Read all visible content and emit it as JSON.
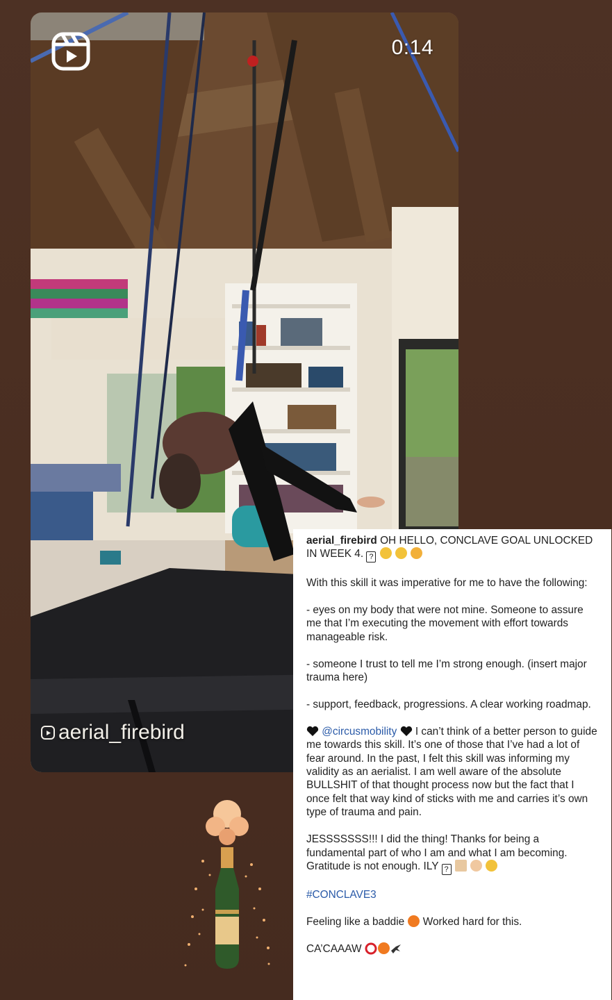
{
  "video": {
    "timer": "0:14",
    "watermark": "aerial_firebird",
    "reel_icon": "reels-icon"
  },
  "caption": {
    "username": "aerial_firebird",
    "headline": " OH HELLO, CONCLAVE GOAL UNLOCKED IN WEEK 4. ",
    "para1": "With this skill it was imperative for me to have the following:",
    "para2": "- eyes on my body that were not mine. Someone to assure me that I’m executing the movement with effort towards manageable risk.",
    "para3": "- someone I trust to tell me I’m strong enough. (insert major trauma here)",
    "para4": "- support, feedback, progressions. A clear working roadmap.",
    "mention": "@circusmobility",
    "para5_rest": " I can’t think of a better person to guide me towards this skill. It’s one of those that I’ve had a lot of fear around. In the past, I felt this skill was informing my validity as an aerialist. I am well aware of the absolute BULLSHIT of that thought process now but the fact that I once felt that way kind of sticks with me and carries it’s own type of trauma and pain.",
    "para6": "JESSSSSSS!!! I did the thing! Thanks for being a fundamental part of who I am and what I am becoming. Gratitude is not enough. ILY ",
    "hashtag": "#CONCLAVE3",
    "feeling_a": "Feeling like a baddie ",
    "feeling_b": " Worked hard for this.",
    "closing": "CA’CAAAW ",
    "unknown_glyph": "?"
  },
  "colors": {
    "background": "#4a2f22",
    "link": "#2a5aa8"
  }
}
